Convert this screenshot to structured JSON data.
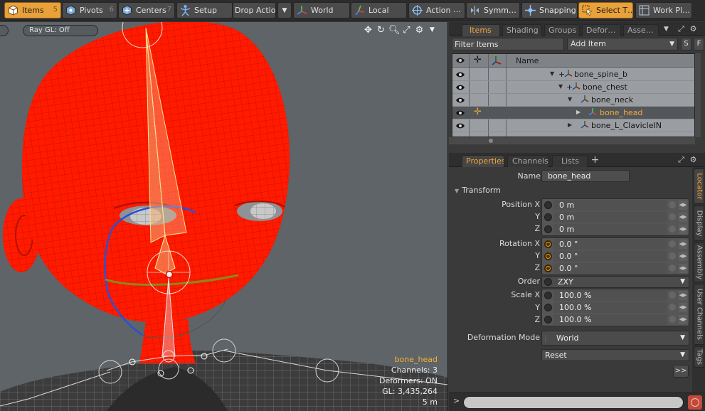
{
  "toolbar": {
    "items": {
      "label": "Items",
      "key": "5",
      "icon": "cube-icon",
      "active": true
    },
    "pivots": {
      "label": "Pivots",
      "key": "6",
      "icon": "pivot-icon"
    },
    "centers": {
      "label": "Centers",
      "key": "7",
      "icon": "center-icon"
    },
    "setup": {
      "label": "Setup",
      "icon": "skeleton-icon"
    },
    "drop_action": {
      "label": "Drop Action"
    },
    "world": {
      "label": "World",
      "icon": "axes-icon"
    },
    "local": {
      "label": "Local",
      "icon": "axes-icon"
    },
    "action": {
      "label": "Action",
      "icon": "crosshair-icon"
    },
    "symmetry": {
      "label": "Symm…",
      "icon": "symmetry-icon"
    },
    "snapping": {
      "label": "Snapping",
      "icon": "snap-icon"
    },
    "select_through": {
      "label": "Select T…",
      "icon": "select-through-icon",
      "active": true
    },
    "work_plane": {
      "label": "Work Pl…",
      "icon": "workplane-icon"
    }
  },
  "viewport": {
    "ray_gl": "Ray GL: Off",
    "info": {
      "selected": "bone_head",
      "channels": "Channels: 3",
      "deformers": "Deformers: ON",
      "gl": "GL: 3,435,264",
      "distance": "5 m"
    }
  },
  "items_panel": {
    "tabs": [
      "Items",
      "Shading",
      "Groups",
      "Defor…",
      "Asse…"
    ],
    "active_tab": "Items",
    "filter_placeholder": "Filter Items",
    "add_item": "Add Item",
    "s_button": "S",
    "f_button": "F",
    "name_header": "Name",
    "rows": [
      {
        "label": "bone_spine_b",
        "selected": false
      },
      {
        "label": "bone_chest",
        "selected": false
      },
      {
        "label": "bone_neck",
        "selected": false
      },
      {
        "label": "bone_head",
        "selected": true
      },
      {
        "label": "bone_L_ClavicleIN",
        "selected": false
      }
    ]
  },
  "properties_panel": {
    "tabs": [
      "Properties",
      "Channels",
      "Lists"
    ],
    "add_tab": "+",
    "name_label": "Name",
    "name_value": "bone_head",
    "transform_header": "Transform",
    "position_label": "Position X",
    "position": [
      "0 m",
      "0 m",
      "0 m"
    ],
    "rotation_label": "Rotation X",
    "rotation": [
      "0.0 °",
      "0.0 °",
      "0.0 °"
    ],
    "y_label": "Y",
    "z_label": "Z",
    "order_label": "Order",
    "order_value": "ZXY",
    "scale_label": "Scale X",
    "scale": [
      "100.0 %",
      "100.0 %",
      "100.0 %"
    ],
    "deformation_label": "Deformation Mode",
    "deformation_value": "World",
    "reset_label": "Reset",
    "expand_label": ">>",
    "side_tabs": [
      "Locator",
      "Display",
      "Assembly",
      "User Channels",
      "Tags"
    ]
  },
  "command_bar": {
    "prompt": ">"
  },
  "colors": {
    "accent": "#e9a13a",
    "mesh": "#ff1a00",
    "viewport_bg": "#5e6468"
  }
}
